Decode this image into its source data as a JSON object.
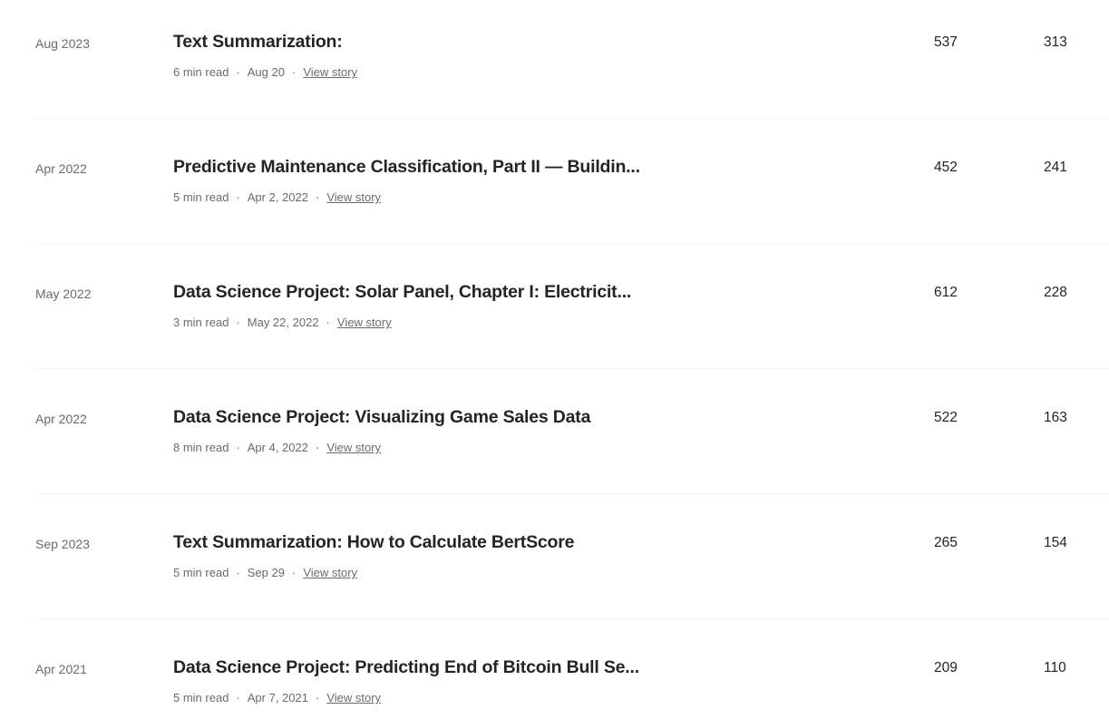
{
  "stories": [
    {
      "date": "Aug 2023",
      "title": "Text Summarization:",
      "read_time": "6 min read",
      "published": "Aug 20",
      "view_label": "View story",
      "views": "537",
      "reads": "313"
    },
    {
      "date": "Apr 2022",
      "title": "Predictive Maintenance Classification, Part II — Buildin...",
      "read_time": "5 min read",
      "published": "Apr 2, 2022",
      "view_label": "View story",
      "views": "452",
      "reads": "241"
    },
    {
      "date": "May 2022",
      "title": "Data Science Project: Solar Panel, Chapter I: Electricit...",
      "read_time": "3 min read",
      "published": "May 22, 2022",
      "view_label": "View story",
      "views": "612",
      "reads": "228"
    },
    {
      "date": "Apr 2022",
      "title": "Data Science Project: Visualizing Game Sales Data",
      "read_time": "8 min read",
      "published": "Apr 4, 2022",
      "view_label": "View story",
      "views": "522",
      "reads": "163"
    },
    {
      "date": "Sep 2023",
      "title": "Text Summarization: How to Calculate BertScore",
      "read_time": "5 min read",
      "published": "Sep 29",
      "view_label": "View story",
      "views": "265",
      "reads": "154"
    },
    {
      "date": "Apr 2021",
      "title": "Data Science Project: Predicting End of Bitcoin Bull Se...",
      "read_time": "5 min read",
      "published": "Apr 7, 2021",
      "view_label": "View story",
      "views": "209",
      "reads": "110"
    }
  ],
  "meta_separator": "·"
}
